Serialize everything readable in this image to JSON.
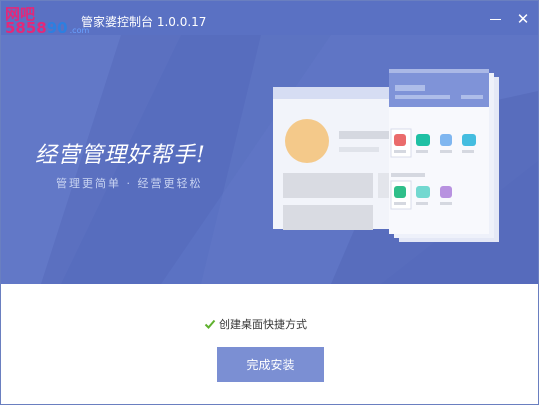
{
  "window": {
    "title": "管家婆控制台 1.0.0.17",
    "watermark_top": "网吧",
    "watermark_bottom": "5858",
    "watermark_bottom_2": "90",
    "watermark_small": ".com"
  },
  "hero": {
    "slogan": "经营管理好帮手!",
    "subslogan": "管理更简单 · 经营更轻松"
  },
  "footer": {
    "shortcut_label": "创建桌面快捷方式",
    "shortcut_checked": true,
    "finish_label": "完成安装"
  },
  "colors": {
    "hero_bg": "#5b72c3",
    "button_bg": "#7b8fd3",
    "check_green": "#5fb12e"
  }
}
